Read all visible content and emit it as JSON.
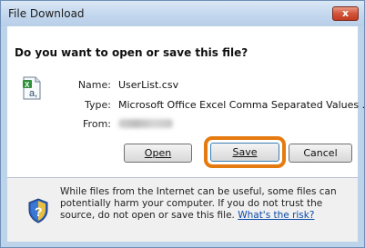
{
  "window": {
    "title": "File Download",
    "close_label": "x"
  },
  "dialog": {
    "heading": "Do you want to open or save this file?",
    "file_icon": "excel-csv-file-icon",
    "fields": {
      "name_label": "Name:",
      "name_value": "UserList.csv",
      "type_label": "Type:",
      "type_value": "Microsoft Office Excel Comma Separated Values ...",
      "from_label": "From:"
    },
    "buttons": {
      "open": "Open",
      "save": "Save",
      "cancel": "Cancel"
    },
    "highlight_color": "#e57b10"
  },
  "footer": {
    "shield_icon": "security-shield-question-icon",
    "warning_text": "While files from the Internet can be useful, some files can potentially harm your computer. If you do not trust the source, do not open or save this file.",
    "link_text": "What's the risk?"
  }
}
